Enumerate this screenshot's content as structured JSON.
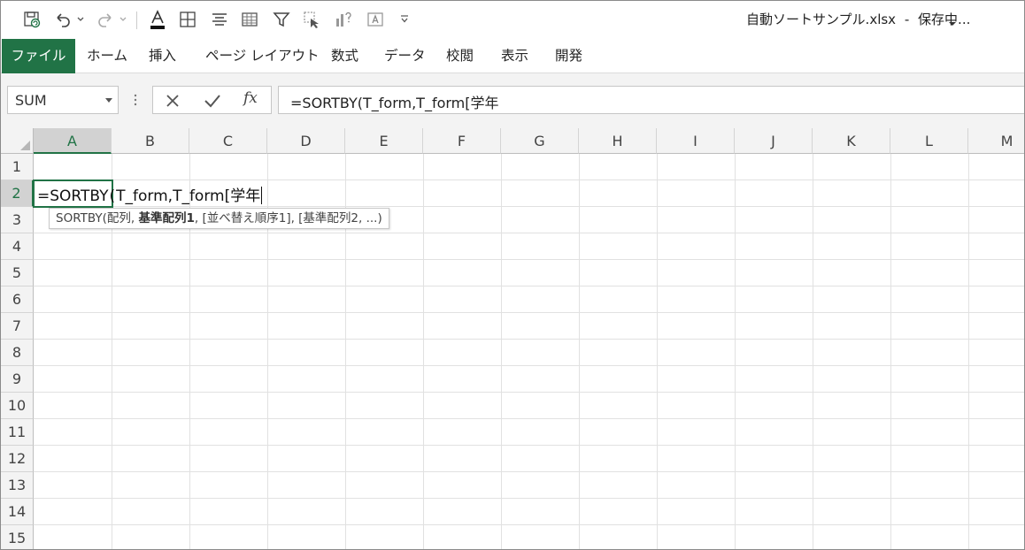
{
  "title": {
    "filename": "自動ソートサンプル.xlsx",
    "separator": "-",
    "status": "保存中..."
  },
  "quick_access": {
    "icons": [
      "save-autosave-icon",
      "undo-icon",
      "redo-icon",
      "font-color-icon",
      "borders-icon",
      "align-center-icon",
      "table-icon",
      "filter-icon",
      "select-objects-icon",
      "chart-help-icon",
      "textbox-icon",
      "customize-qat-icon"
    ]
  },
  "ribbon": {
    "tabs": [
      "ファイル",
      "ホーム",
      "挿入",
      "ページ レイアウト",
      "数式",
      "データ",
      "校閲",
      "表示",
      "開発"
    ]
  },
  "formula_bar": {
    "name_box": "SUM",
    "cancel_glyph": "✕",
    "enter_glyph": "✓",
    "fx_label": "fx",
    "formula": "=SORTBY(T_form,T_form[学年"
  },
  "grid": {
    "columns": [
      "A",
      "B",
      "C",
      "D",
      "E",
      "F",
      "G",
      "H",
      "I",
      "J",
      "K",
      "L",
      "M"
    ],
    "rows": [
      "1",
      "2",
      "3",
      "4",
      "5",
      "6",
      "7",
      "8",
      "9",
      "10",
      "11",
      "12",
      "13",
      "14",
      "15"
    ],
    "active_column": "A",
    "active_row": "2"
  },
  "cell_edit": {
    "text_before_paren": "=SORTBY",
    "text_after_paren": "T_form,T_form[学年"
  },
  "tooltip": {
    "func_prefix": "SORTBY(配列, ",
    "current_arg": "基準配列1",
    "rest": ", [並べ替え順序1], [基準配列2, ...)"
  },
  "colors": {
    "accent": "#217346",
    "header_bg": "#f3f3f3",
    "gridline": "#e1e1e1"
  }
}
